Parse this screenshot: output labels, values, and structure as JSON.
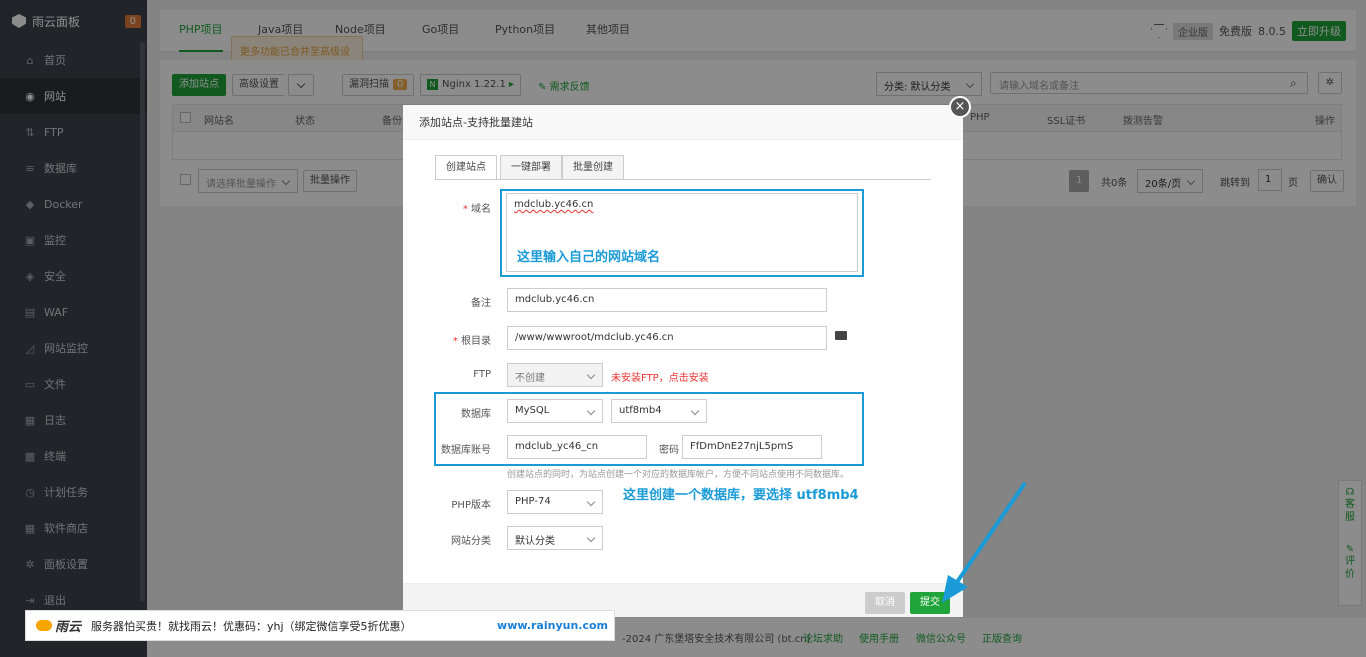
{
  "sidebar": {
    "title": "雨云面板",
    "badge": "0",
    "items": [
      {
        "label": "首页",
        "icon": "home-icon",
        "glyph": "⌂"
      },
      {
        "label": "网站",
        "icon": "globe-icon",
        "glyph": "◉"
      },
      {
        "label": "FTP",
        "icon": "ftp-icon",
        "glyph": "⇅"
      },
      {
        "label": "数据库",
        "icon": "database-icon",
        "glyph": "≡"
      },
      {
        "label": "Docker",
        "icon": "docker-icon",
        "glyph": "◆"
      },
      {
        "label": "监控",
        "icon": "monitor-icon",
        "glyph": "▣"
      },
      {
        "label": "安全",
        "icon": "shield-icon",
        "glyph": "◈"
      },
      {
        "label": "WAF",
        "icon": "waf-icon",
        "glyph": "▤"
      },
      {
        "label": "网站监控",
        "icon": "chart-icon",
        "glyph": "◿"
      },
      {
        "label": "文件",
        "icon": "folder-icon",
        "glyph": "▭"
      },
      {
        "label": "日志",
        "icon": "log-icon",
        "glyph": "▦"
      },
      {
        "label": "终端",
        "icon": "terminal-icon",
        "glyph": "▩"
      },
      {
        "label": "计划任务",
        "icon": "clock-icon",
        "glyph": "◷"
      },
      {
        "label": "软件商店",
        "icon": "grid-icon",
        "glyph": "▦"
      },
      {
        "label": "面板设置",
        "icon": "gear-icon",
        "glyph": "✲"
      },
      {
        "label": "退出",
        "icon": "logout-icon",
        "glyph": "⇥"
      }
    ]
  },
  "tabs": [
    "PHP项目",
    "Java项目",
    "Node项目",
    "Go项目",
    "Python项目",
    "其他项目"
  ],
  "top_right": {
    "edition": "企业版",
    "free": "免费版",
    "version": "8.0.5",
    "upgrade": "立即升级"
  },
  "tooltip": "更多功能已合并至高级设置",
  "toolbar": {
    "add_site": "添加站点",
    "advanced": "高级设置",
    "vuln_scan": "漏洞扫描",
    "vuln_count": "0",
    "nginx": "Nginx 1.22.1",
    "feedback": "需求反馈",
    "category": "分类: 默认分类",
    "search_placeholder": "请输入域名或备注"
  },
  "table_headers": {
    "name": "网站名",
    "status": "状态",
    "backup": "备份",
    "php": "PHP",
    "ssl": "SSL证书",
    "alert": "拨测告警",
    "ops": "操作"
  },
  "table_footer": {
    "batch_select": "请选择批量操作",
    "batch_btn": "批量操作",
    "page": "1",
    "total": "共0条",
    "per_page": "20条/页",
    "goto": "跳转到",
    "goto_page": "1",
    "page_unit": "页",
    "confirm": "确认"
  },
  "modal": {
    "title": "添加站点-支持批量建站",
    "tabs": [
      "创建站点",
      "一键部署",
      "批量创建"
    ],
    "domain_label": "域名",
    "domain_value": "mdclub.yc46.cn",
    "domain_note": "这里输入自己的网站域名",
    "remark_label": "备注",
    "remark_value": "mdclub.yc46.cn",
    "root_label": "根目录",
    "root_value": "/www/wwwroot/mdclub.yc46.cn",
    "ftp_label": "FTP",
    "ftp_value": "不创建",
    "ftp_warn": "未安装FTP，点击安装",
    "db_label": "数据库",
    "db_type": "MySQL",
    "db_charset": "utf8mb4",
    "dbuser_label": "数据库账号",
    "dbuser_value": "mdclub_yc46_cn",
    "pwd_label": "密码",
    "pwd_value": "FfDmDnE27njL5pmS",
    "db_hint": "创建站点的同时，为站点创建一个对应的数据库帐户，方便不同站点使用不同数据库。",
    "db_note": "这里创建一个数据库，要选择 utf8mb4",
    "php_label": "PHP版本",
    "php_value": "PHP-74",
    "cat_label": "网站分类",
    "cat_value": "默认分类",
    "cancel": "取消",
    "submit": "提交"
  },
  "footer": {
    "copy": "-2024 广东堡塔安全技术有限公司 (bt.cn)",
    "links": [
      "论坛求助",
      "使用手册",
      "微信公众号",
      "正版查询"
    ]
  },
  "promo": {
    "brand": "雨云",
    "text": "服务器怕买贵！就找雨云！优惠码：yhj（绑定微信享受5折优惠）",
    "url": "www.rainyun.com"
  },
  "float": {
    "service": "客服",
    "review": "评价"
  }
}
